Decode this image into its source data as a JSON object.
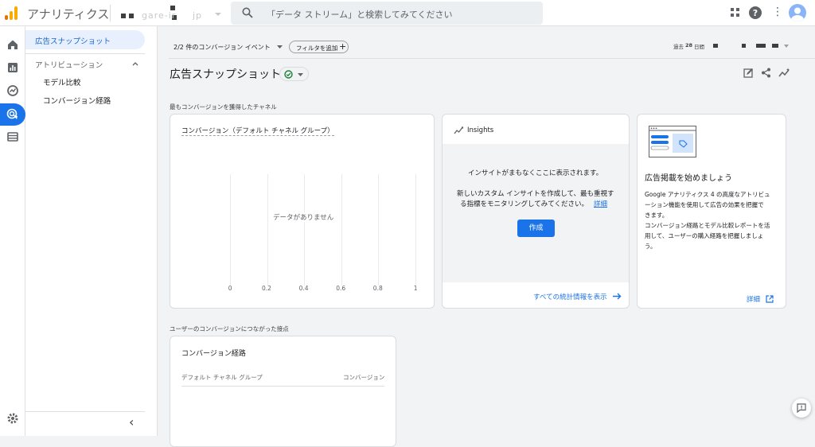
{
  "app": {
    "title": "アナリティクス",
    "account_masked": "gare-ir",
    "account_suffix": "jp"
  },
  "search": {
    "placeholder": "「データ ストリーム」と検索してみてください"
  },
  "header": {
    "help_glyph": "?",
    "more_glyph": "⋮"
  },
  "subnav": {
    "items": [
      {
        "label": "広告スナップショット",
        "selected": true
      },
      {
        "label": "アトリビューション",
        "section": true
      },
      {
        "label": "モデル比較"
      },
      {
        "label": "コンバージョン経路"
      }
    ],
    "collapse_glyph": "‹"
  },
  "toolbar": {
    "conversion_events": "2/2 件のコンバージョン イベント",
    "add_filter": "フィルタを追加",
    "date_prefix": "過去",
    "date_days": "28",
    "date_suffix": "日間"
  },
  "page": {
    "title": "広告スナップショット"
  },
  "section1": {
    "label": "最もコンバージョンを獲得したチャネル"
  },
  "chart_card": {
    "title": "コンバージョン（デフォルト チャネル グループ）",
    "empty": "データがありません"
  },
  "chart_data": {
    "type": "bar",
    "title": "コンバージョン（デフォルト チャネル グループ）",
    "categories": [],
    "values": [],
    "x_ticks": [
      "0",
      "0.2",
      "0.4",
      "0.6",
      "0.8",
      "1"
    ],
    "xlim": [
      0,
      1
    ],
    "orientation": "horizontal",
    "grid": true,
    "note_text": "データがありません"
  },
  "insights_card": {
    "title": "Insights",
    "headline": "インサイトがまもなくここに表示されます。",
    "body_line1": "新しいカスタム インサイトを作成して、最も重視す",
    "body_line2": "る指標をモニタリングしてみてください。",
    "learn_more": "詳細",
    "create_button": "作成",
    "view_all": "すべての統計情報を表示"
  },
  "promo_card": {
    "title": "広告掲載を始めましょう",
    "p1_l1": "Google アナリティクス 4 の高度なアトリビュ",
    "p1_l2": "ーション機能を使用して広告の効果を把握で",
    "p1_l3": "きます。",
    "p2_l1": "コンバージョン経路とモデル比較レポートを活",
    "p2_l2": "用して、ユーザーの購入経路を把握しましょ",
    "p2_l3": "う。",
    "details": "詳細"
  },
  "section2": {
    "label": "ユーザーのコンバージョンにつながった接点"
  },
  "path_card": {
    "title": "コンバージョン経路",
    "col1": "デフォルト チャネル グループ",
    "col2": "コンバージョン"
  },
  "colors": {
    "accent": "#1a73e8",
    "success": "#188038",
    "logo_orange": "#f9ab00"
  }
}
